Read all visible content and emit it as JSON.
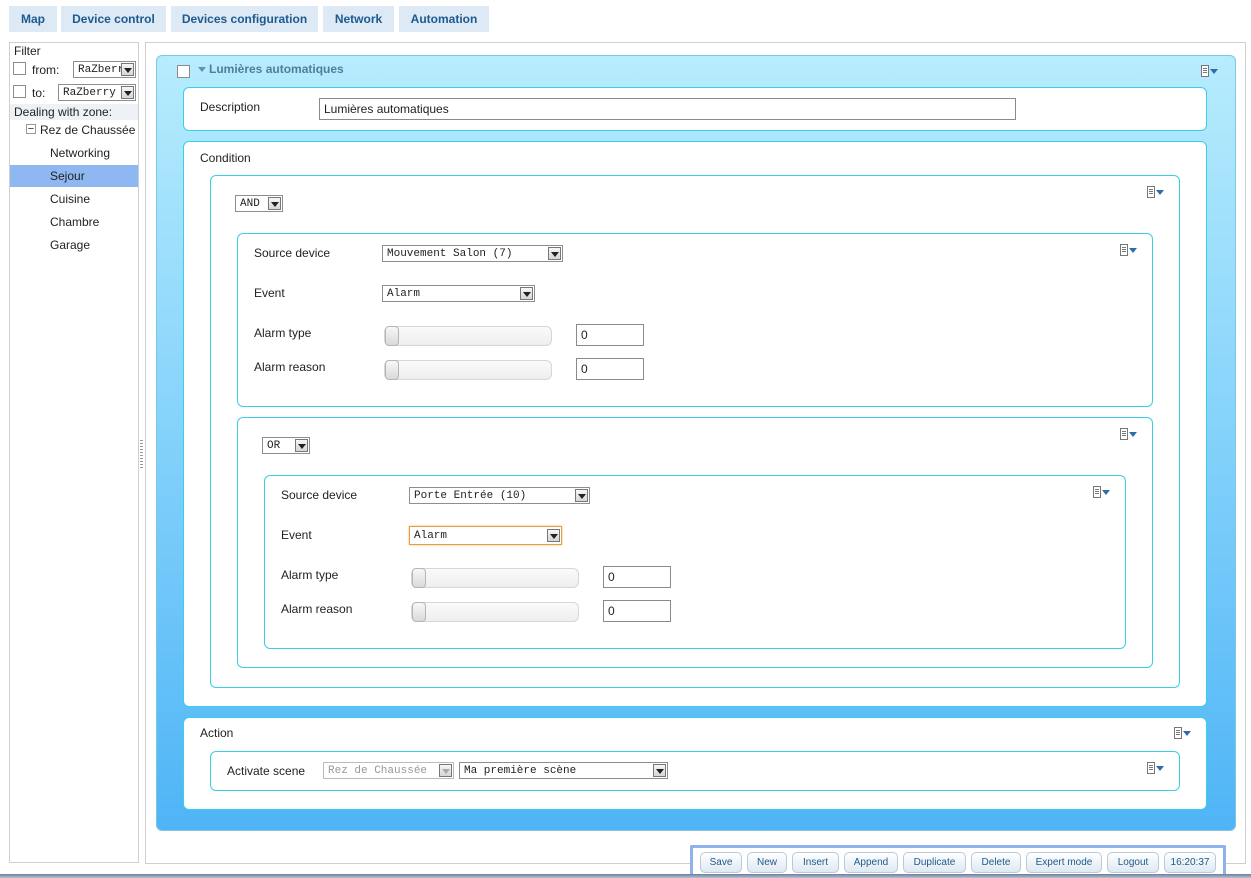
{
  "tabs": [
    "Map",
    "Device control",
    "Devices configuration",
    "Network",
    "Automation"
  ],
  "sidebar": {
    "filter_label": "Filter",
    "from_label": "from:",
    "from_value": "RaZberry",
    "to_label": "to:",
    "to_value": "RaZberry",
    "zone_heading": "Dealing with zone:",
    "floor": "Rez de Chaussée",
    "tree_toggle": "−",
    "zones": [
      "Networking",
      "Sejour",
      "Cuisine",
      "Chambre",
      "Garage"
    ],
    "active_zone": "Sejour"
  },
  "rule": {
    "title": "Lumières automatiques",
    "description_label": "Description",
    "description_value": "Lumières automatiques",
    "condition_label": "Condition",
    "and_operator": "AND",
    "cond1": {
      "source_label": "Source device",
      "source_value": "Mouvement Salon (7)",
      "event_label": "Event",
      "event_value": "Alarm",
      "alarm_type_label": "Alarm type",
      "alarm_type_value": "0",
      "alarm_reason_label": "Alarm reason",
      "alarm_reason_value": "0"
    },
    "or_operator": "OR",
    "cond2": {
      "source_label": "Source device",
      "source_value": "Porte Entrée (10)",
      "event_label": "Event",
      "event_value": "Alarm",
      "alarm_type_label": "Alarm type",
      "alarm_type_value": "0",
      "alarm_reason_label": "Alarm reason",
      "alarm_reason_value": "0"
    },
    "action_label": "Action",
    "activate_scene_label": "Activate scene",
    "scene_zone": "Rez de Chaussée",
    "scene_value": "Ma première scène"
  },
  "buttons": [
    "Save",
    "New",
    "Insert",
    "Append",
    "Duplicate",
    "Delete",
    "Expert mode",
    "Logout"
  ],
  "clock": "16:20:37",
  "colors": {
    "tab_bg": "#dde9f4",
    "tab_text": "#1d5a8f",
    "active_zone": "#8fb7f2",
    "panel_border": "#38d0e6",
    "rule_gradient_top": "#b7ecfd",
    "rule_gradient_bottom": "#4fb4f6"
  },
  "icons": [
    "chevron-down-icon",
    "menu-icon",
    "dropdown-arrow-icon",
    "tree-collapse-icon",
    "checkbox"
  ]
}
